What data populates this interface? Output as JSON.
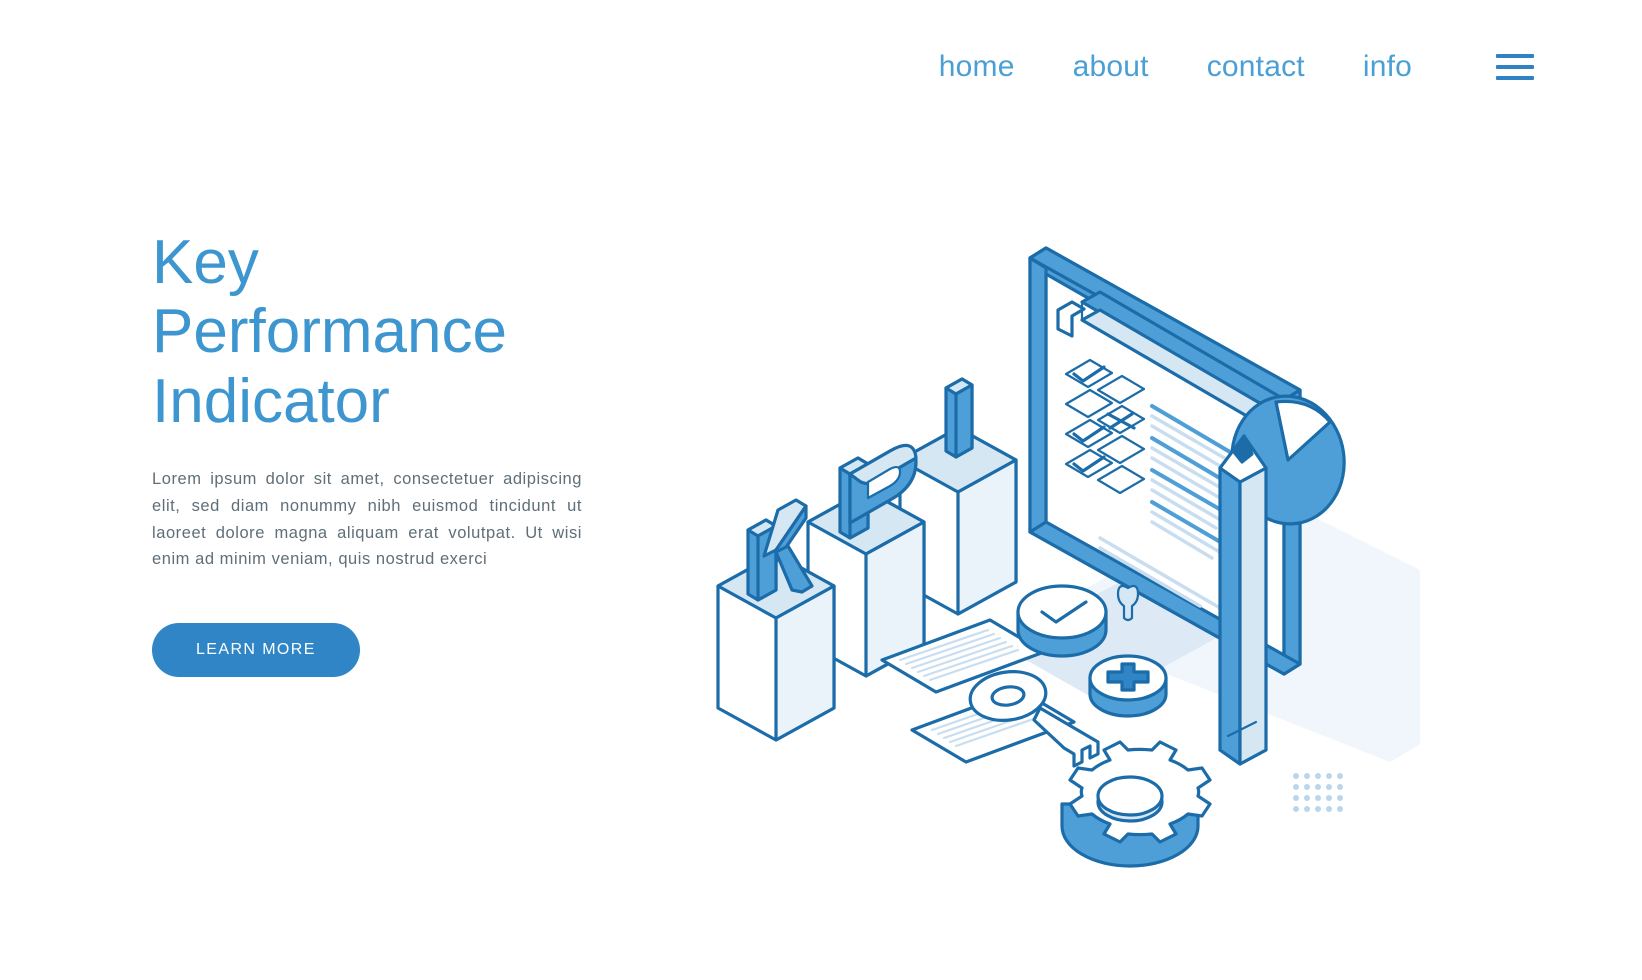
{
  "nav": {
    "items": [
      {
        "label": "home",
        "name": "nav-link-home"
      },
      {
        "label": "about",
        "name": "nav-link-about"
      },
      {
        "label": "contact",
        "name": "nav-link-contact"
      },
      {
        "label": "info",
        "name": "nav-link-info"
      }
    ],
    "menu_icon": "hamburger-menu-icon"
  },
  "hero": {
    "title": "Key\nPerformance\nIndicator",
    "paragraph": "Lorem ipsum dolor sit amet, consectetuer adipiscing elit, sed diam nonummy nibh euismod tincidunt ut laoreet dolore magna aliquam erat volutpat. Ut wisi enim ad minim veniam, quis nostrud exerci",
    "cta_label": "LEARN MORE"
  },
  "illustration": {
    "name": "kpi-isometric-illustration",
    "elements": [
      "bar-chart-ascending",
      "letter-k-block",
      "letter-p-block",
      "letter-i-block",
      "clipboard-checklist",
      "checkbox-checked",
      "checkbox-empty",
      "checkbox-x-mark",
      "pie-chart",
      "pencil",
      "document-page",
      "key",
      "check-circle-button",
      "plus-circle-button",
      "gear-cog",
      "dot-grid"
    ]
  },
  "colors": {
    "accent": "#2f85c6",
    "title": "#3d96cf",
    "nav": "#4a9fd4",
    "body_text": "#5f6e78",
    "line_dark": "#1b6ca8",
    "fill_mid": "#4e9fd8",
    "fill_light": "#d8e8f5",
    "fill_pale": "#eef5fb",
    "background": "#ffffff"
  }
}
